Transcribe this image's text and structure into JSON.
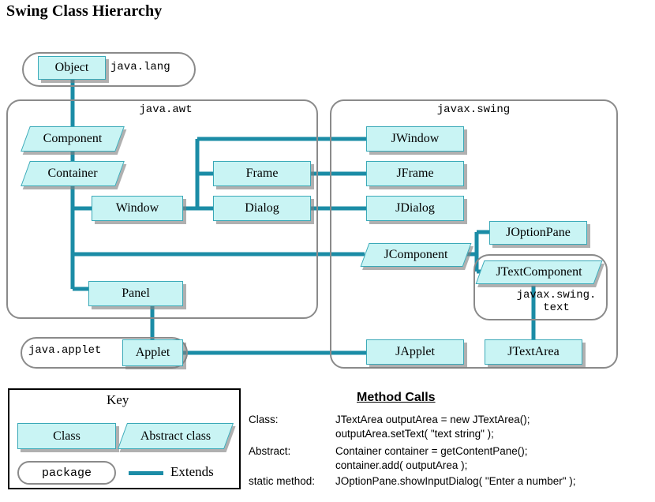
{
  "title": "Swing Class Hierarchy",
  "packages": [
    {
      "id": "java_lang",
      "label": "java.lang"
    },
    {
      "id": "java_awt",
      "label": "java.awt"
    },
    {
      "id": "javax_swing",
      "label": "javax.swing"
    },
    {
      "id": "javax_swing_text",
      "label": "javax.swing.\ntext"
    },
    {
      "id": "java_applet",
      "label": "java.applet"
    }
  ],
  "classes": [
    {
      "id": "object",
      "label": "Object",
      "kind": "class",
      "package": "java.lang"
    },
    {
      "id": "component",
      "label": "Component",
      "kind": "abstract",
      "package": "java.awt"
    },
    {
      "id": "container",
      "label": "Container",
      "kind": "abstract",
      "package": "java.awt"
    },
    {
      "id": "window",
      "label": "Window",
      "kind": "class",
      "package": "java.awt"
    },
    {
      "id": "frame",
      "label": "Frame",
      "kind": "class",
      "package": "java.awt"
    },
    {
      "id": "dialog",
      "label": "Dialog",
      "kind": "class",
      "package": "java.awt"
    },
    {
      "id": "panel",
      "label": "Panel",
      "kind": "class",
      "package": "java.awt"
    },
    {
      "id": "applet",
      "label": "Applet",
      "kind": "class",
      "package": "java.applet"
    },
    {
      "id": "jwindow",
      "label": "JWindow",
      "kind": "class",
      "package": "javax.swing"
    },
    {
      "id": "jframe",
      "label": "JFrame",
      "kind": "class",
      "package": "javax.swing"
    },
    {
      "id": "jdialog",
      "label": "JDialog",
      "kind": "class",
      "package": "javax.swing"
    },
    {
      "id": "jcomponent",
      "label": "JComponent",
      "kind": "abstract",
      "package": "javax.swing"
    },
    {
      "id": "joptionpane",
      "label": "JOptionPane",
      "kind": "class",
      "package": "javax.swing"
    },
    {
      "id": "jtextcomponent",
      "label": "JTextComponent",
      "kind": "abstract",
      "package": "javax.swing.text"
    },
    {
      "id": "japplet",
      "label": "JApplet",
      "kind": "class",
      "package": "javax.swing"
    },
    {
      "id": "jtextarea",
      "label": "JTextArea",
      "kind": "class",
      "package": "javax.swing.text"
    }
  ],
  "edges": [
    {
      "from": "Object",
      "to": "Component",
      "relation": "Extends"
    },
    {
      "from": "Component",
      "to": "Container",
      "relation": "Extends"
    },
    {
      "from": "Container",
      "to": "Window",
      "relation": "Extends"
    },
    {
      "from": "Container",
      "to": "Panel",
      "relation": "Extends"
    },
    {
      "from": "Container",
      "to": "JComponent",
      "relation": "Extends"
    },
    {
      "from": "Window",
      "to": "Frame",
      "relation": "Extends"
    },
    {
      "from": "Window",
      "to": "Dialog",
      "relation": "Extends"
    },
    {
      "from": "Window",
      "to": "JWindow",
      "relation": "Extends"
    },
    {
      "from": "Frame",
      "to": "JFrame",
      "relation": "Extends"
    },
    {
      "from": "Dialog",
      "to": "JDialog",
      "relation": "Extends"
    },
    {
      "from": "Panel",
      "to": "Applet",
      "relation": "Extends"
    },
    {
      "from": "Applet",
      "to": "JApplet",
      "relation": "Extends"
    },
    {
      "from": "JComponent",
      "to": "JOptionPane",
      "relation": "Extends"
    },
    {
      "from": "JComponent",
      "to": "JTextComponent",
      "relation": "Extends"
    },
    {
      "from": "JTextComponent",
      "to": "JTextArea",
      "relation": "Extends"
    }
  ],
  "key": {
    "title": "Key",
    "class_label": "Class",
    "abstract_label": "Abstract class",
    "package_label": "package",
    "extends_label": "Extends"
  },
  "method_calls": {
    "title": "Method Calls",
    "rows": [
      {
        "label": "Class:",
        "code1": "JTextArea outputArea = new JTextArea();",
        "code2": "outputArea.setText( \"text string\" );"
      },
      {
        "label": "Abstract:",
        "code1": "Container container = getContentPane();",
        "code2": "container.add( outputArea );"
      },
      {
        "label": "static method:",
        "code1": "JOptionPane.showInputDialog( \"Enter a number\" );",
        "code2": ""
      }
    ]
  },
  "colors": {
    "node_fill": "#c9f4f4",
    "node_border": "#3aa9b8",
    "edge": "#1b8ca6",
    "package_border": "#8a8a8a",
    "shadow": "#808080",
    "text": "#000000"
  }
}
